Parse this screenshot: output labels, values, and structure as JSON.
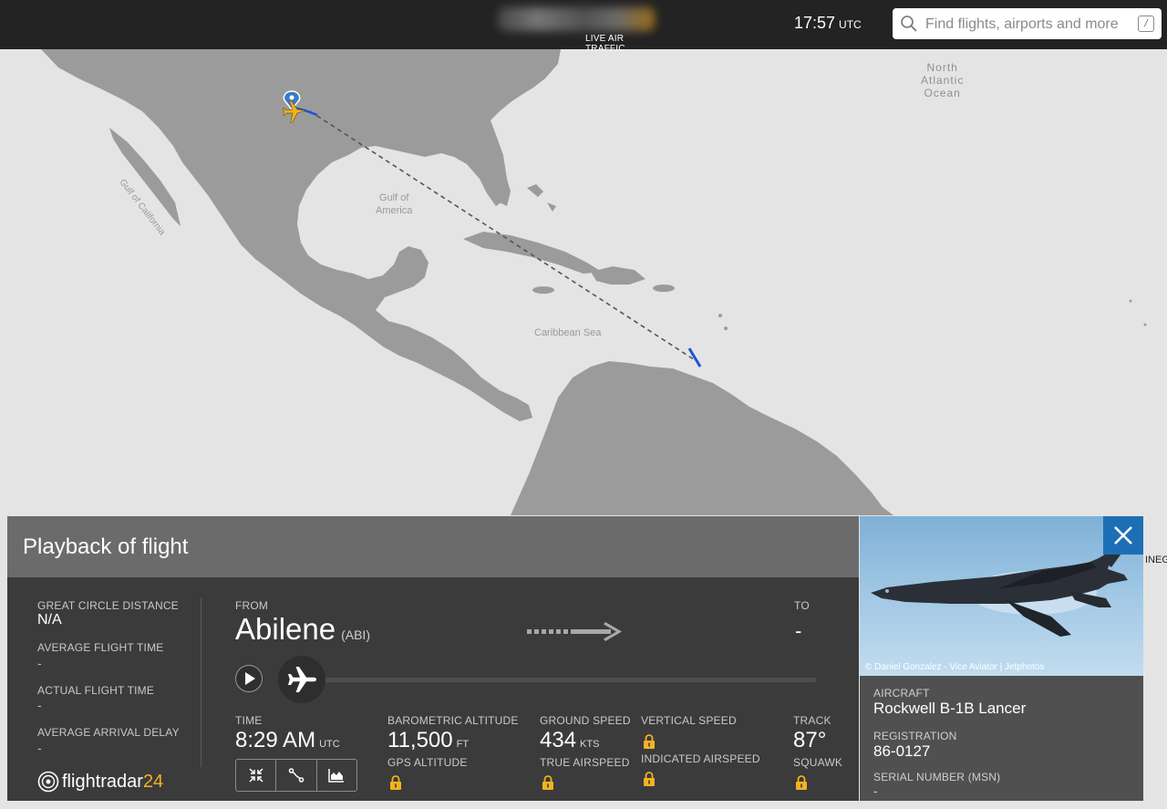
{
  "header": {
    "logo_subtitle": "LIVE AIR TRAFFIC",
    "clock_time": "17:57",
    "clock_zone": "UTC",
    "search_placeholder": "Find flights, airports and more",
    "search_shortcut": "/"
  },
  "map": {
    "labels": {
      "ocean": "North\nAtlantic\nOcean",
      "gulf": "Gulf of\nAmerica",
      "caribbean": "Caribbean Sea",
      "gulf_california": "Gulf of California"
    },
    "edge_text": "INEG",
    "colors": {
      "route": "#1a55d6",
      "land": "#9a9a9a",
      "water": "#e4e4e4",
      "plane": "#f2b221"
    }
  },
  "panel": {
    "title": "Playback of flight",
    "left": {
      "gcd_label": "GREAT CIRCLE DISTANCE",
      "gcd_value": "N/A",
      "avg_time_label": "AVERAGE FLIGHT TIME",
      "avg_time_value": "-",
      "actual_time_label": "ACTUAL FLIGHT TIME",
      "actual_time_value": "-",
      "avg_delay_label": "AVERAGE ARRIVAL DELAY",
      "avg_delay_value": "-",
      "brand_main": "flightradar",
      "brand_num": "24"
    },
    "route": {
      "from_label": "FROM",
      "from_city": "Abilene",
      "from_code": "(ABI)",
      "to_label": "TO",
      "to_city": "-"
    },
    "stats": {
      "time_label": "TIME",
      "time_value": "8:29 AM",
      "time_unit": "UTC",
      "baro_label": "BAROMETRIC ALTITUDE",
      "baro_value": "11,500",
      "baro_unit": "FT",
      "gps_label": "GPS ALTITUDE",
      "gs_label": "GROUND SPEED",
      "gs_value": "434",
      "gs_unit": "KTS",
      "tas_label": "TRUE AIRSPEED",
      "vs_label": "VERTICAL SPEED",
      "ias_label": "INDICATED AIRSPEED",
      "track_label": "TRACK",
      "track_value": "87°",
      "squawk_label": "SQUAWK"
    }
  },
  "aircraft": {
    "photo_credit": "© Daniel Gonzalez - Vice Aviator | Jetphotos",
    "aircraft_label": "AIRCRAFT",
    "aircraft_value": "Rockwell B-1B Lancer",
    "registration_label": "REGISTRATION",
    "registration_value": "86-0127",
    "serial_label": "SERIAL NUMBER (MSN)",
    "serial_value": "-"
  }
}
